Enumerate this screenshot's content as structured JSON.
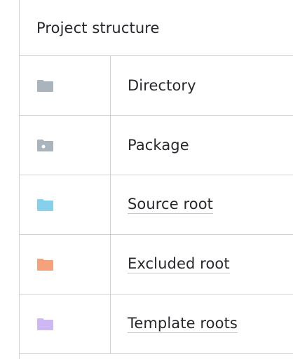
{
  "header": {
    "title": "Project structure"
  },
  "rows": [
    {
      "label": "Directory",
      "icon": "folder-icon",
      "color": "#aab4bc",
      "underlined": false
    },
    {
      "label": "Package",
      "icon": "package-folder-icon",
      "color": "#aab4bc",
      "underlined": false
    },
    {
      "label": "Source root",
      "icon": "source-root-folder-icon",
      "color": "#87d0ec",
      "underlined": true
    },
    {
      "label": "Excluded root",
      "icon": "excluded-root-folder-icon",
      "color": "#f5a27c",
      "underlined": true
    },
    {
      "label": "Template roots",
      "icon": "template-root-folder-icon",
      "color": "#cdb8f4",
      "underlined": true
    }
  ]
}
